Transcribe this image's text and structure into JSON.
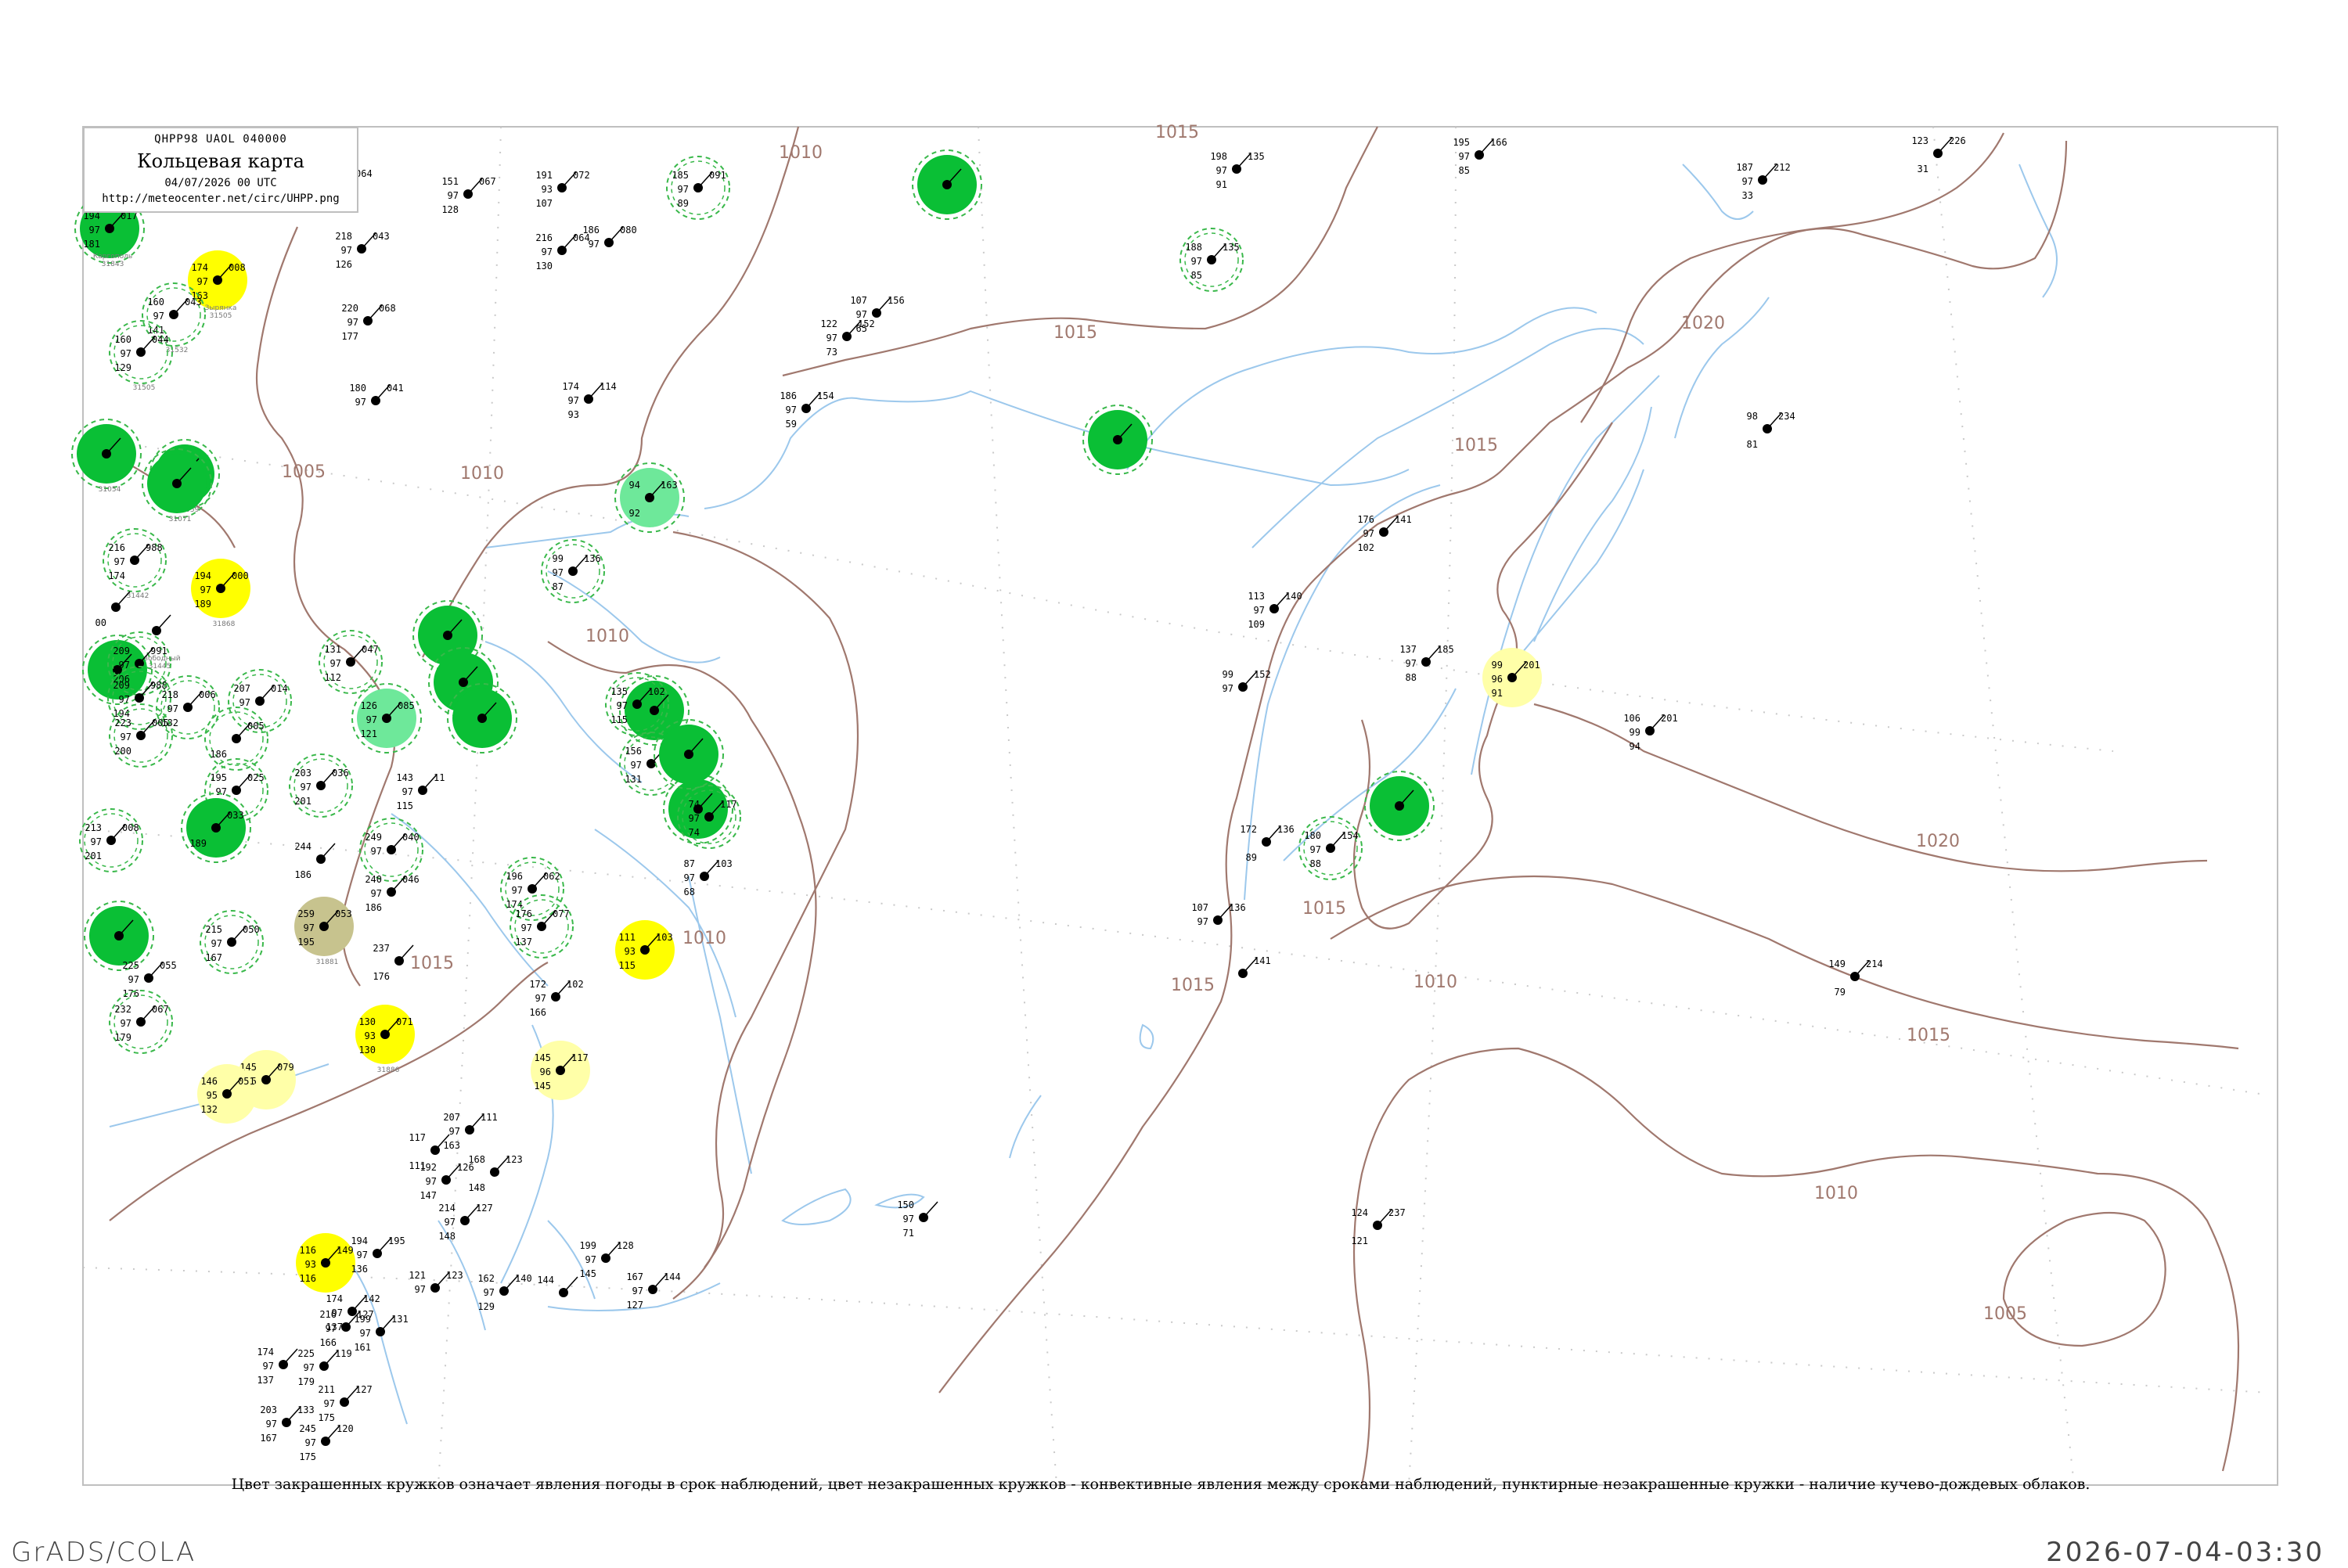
{
  "header": {
    "code": "QHPP98  UAOL  040000",
    "title": "Кольцевая карта",
    "datetime": "04/07/2026 00 UTC",
    "url": "http://meteocenter.net/circ/UHPP.png"
  },
  "footnote": "Цвет закрашенных кружков означает явления погоды в срок наблюдений, цвет незакрашенных кружков - конвективные явления между сроками наблюдений, пунктирные незакрашенные кружки - наличие кучево-дождевых облаков.",
  "footer": {
    "software": "GrADS/COLA",
    "timestamp": "2026-07-04-03:30"
  },
  "colors": {
    "isobar": "#a0786e",
    "coast": "#9cc8ec",
    "rain_green": "#0abf35",
    "light_green": "#6ee89a",
    "yellow": "#ffff00",
    "pale_yellow": "#ffffa8",
    "fog_khaki": "#c7c38e",
    "dashed_ring": "#39b84a"
  },
  "isobars": [
    {
      "label": "1005"
    },
    {
      "label": "1010"
    },
    {
      "label": "1015"
    },
    {
      "label": "1020"
    }
  ],
  "stations": [
    {
      "name": "Каргополь",
      "index": "31843",
      "marker": "rain_green",
      "v": [
        "194",
        "97",
        "181",
        "017"
      ]
    },
    {
      "name": "Зырянка",
      "index": "31505",
      "marker": "yellow",
      "v": [
        "174",
        "97",
        "163",
        "008"
      ]
    },
    {
      "name": "",
      "index": "31532",
      "marker": "ring",
      "v": [
        "160",
        "97",
        "141",
        "043"
      ]
    },
    {
      "name": "",
      "index": "31505",
      "marker": "ring",
      "v": [
        "160",
        "97",
        "129",
        "044"
      ]
    },
    {
      "name": "",
      "index": "31054",
      "marker": "rain_green",
      "v": [
        "",
        "",
        "",
        ""
      ]
    },
    {
      "name": "",
      "index": "31059",
      "marker": "rain_green",
      "v": [
        "",
        "",
        "",
        ""
      ]
    },
    {
      "name": "",
      "index": "31071",
      "marker": "rain_green",
      "v": [
        "",
        "",
        "",
        ""
      ]
    },
    {
      "name": "",
      "index": "31442",
      "marker": "ring",
      "v": [
        "216",
        "97",
        "174",
        "988"
      ]
    },
    {
      "name": "",
      "index": "31868",
      "marker": "yellow",
      "v": [
        "194",
        "97",
        "189",
        "000"
      ]
    },
    {
      "name": "",
      "index": "",
      "marker": "none",
      "v": [
        "",
        "",
        "00",
        ""
      ]
    },
    {
      "name": "Свободный",
      "index": "31445",
      "marker": "none",
      "v": [
        "",
        "",
        "",
        ""
      ]
    },
    {
      "name": "",
      "index": "",
      "marker": "rain_green",
      "v": [
        "",
        "",
        "",
        ""
      ]
    },
    {
      "name": "",
      "index": "",
      "marker": "ring",
      "v": [
        "209",
        "97",
        "206",
        "991"
      ]
    },
    {
      "name": "",
      "index": "",
      "marker": "ring",
      "v": [
        "209",
        "97",
        "194",
        "988"
      ]
    },
    {
      "name": "",
      "index": "",
      "marker": "ring",
      "v": [
        "218",
        "97",
        "182",
        "006"
      ]
    },
    {
      "name": "",
      "index": "",
      "marker": "ring",
      "v": [
        "207",
        "97",
        "",
        "014"
      ]
    },
    {
      "name": "",
      "index": "",
      "marker": "ring",
      "v": [
        "223",
        "97",
        "200",
        "005"
      ]
    },
    {
      "name": "",
      "index": "",
      "marker": "ring",
      "v": [
        "",
        "",
        "186",
        "005"
      ]
    },
    {
      "name": "",
      "index": "",
      "marker": "ring",
      "v": [
        "131",
        "97",
        "112",
        "047"
      ]
    },
    {
      "name": "",
      "index": "",
      "marker": "light_green",
      "v": [
        "126",
        "97",
        "121",
        "085"
      ]
    },
    {
      "name": "",
      "index": "",
      "marker": "ring",
      "v": [
        "203",
        "97",
        "201",
        "036"
      ]
    },
    {
      "name": "",
      "index": "",
      "marker": "ring",
      "v": [
        "195",
        "97",
        "",
        "025"
      ]
    },
    {
      "name": "",
      "index": "",
      "marker": "rain_green",
      "v": [
        "",
        "",
        "189",
        "033"
      ]
    },
    {
      "name": "",
      "index": "",
      "marker": "ring",
      "v": [
        "213",
        "97",
        "201",
        "008"
      ]
    },
    {
      "name": "",
      "index": "",
      "marker": "ring",
      "v": [
        "249",
        "97",
        "",
        "040"
      ]
    },
    {
      "name": "",
      "index": "",
      "marker": "none",
      "v": [
        "244",
        "",
        "186",
        ""
      ]
    },
    {
      "name": "",
      "index": "",
      "marker": "none",
      "v": [
        "240",
        "97",
        "186",
        "046"
      ]
    },
    {
      "name": "",
      "index": "31881",
      "marker": "fog_khaki",
      "v": [
        "259",
        "97",
        "195",
        "053"
      ]
    },
    {
      "name": "",
      "index": "",
      "marker": "rain_green",
      "v": [
        "",
        "",
        "",
        ""
      ]
    },
    {
      "name": "",
      "index": "",
      "marker": "ring",
      "v": [
        "215",
        "97",
        "167",
        "050"
      ]
    },
    {
      "name": "",
      "index": "",
      "marker": "none",
      "v": [
        "225",
        "97",
        "176",
        "055"
      ]
    },
    {
      "name": "",
      "index": "",
      "marker": "ring",
      "v": [
        "232",
        "97",
        "179",
        "067"
      ]
    },
    {
      "name": "",
      "index": "31886",
      "marker": "yellow",
      "v": [
        "130",
        "93",
        "130",
        "071"
      ]
    },
    {
      "name": "",
      "index": "",
      "marker": "pale_yellow",
      "v": [
        "145",
        "95",
        "131",
        "079"
      ]
    },
    {
      "name": "",
      "index": "",
      "marker": "pale_yellow",
      "v": [
        "146",
        "95",
        "132",
        "051"
      ]
    },
    {
      "name": "",
      "index": "",
      "marker": "none",
      "v": [
        "237",
        "",
        "176",
        ""
      ]
    },
    {
      "name": "",
      "index": "",
      "marker": "none",
      "v": [
        "209",
        "97",
        "121",
        "064"
      ]
    },
    {
      "name": "",
      "index": "",
      "marker": "none",
      "v": [
        "218",
        "97",
        "126",
        "043"
      ]
    },
    {
      "name": "",
      "index": "",
      "marker": "none",
      "v": [
        "220",
        "97",
        "177",
        "068"
      ]
    },
    {
      "name": "",
      "index": "",
      "marker": "none",
      "v": [
        "180",
        "97",
        "",
        "041"
      ]
    },
    {
      "name": "",
      "index": "",
      "marker": "none",
      "v": [
        "151",
        "97",
        "128",
        "067"
      ]
    },
    {
      "name": "",
      "index": "",
      "marker": "none",
      "v": [
        "191",
        "93",
        "107",
        "072"
      ]
    },
    {
      "name": "",
      "index": "",
      "marker": "none",
      "v": [
        "216",
        "97",
        "130",
        "064"
      ]
    },
    {
      "name": "",
      "index": "",
      "marker": "none",
      "v": [
        "186",
        "97",
        "",
        "080"
      ]
    },
    {
      "name": "",
      "index": "",
      "marker": "none",
      "v": [
        "174",
        "97",
        "93",
        "114"
      ]
    },
    {
      "name": "",
      "index": "",
      "marker": "ring",
      "v": [
        "185",
        "97",
        "89",
        "091"
      ]
    },
    {
      "name": "",
      "index": "",
      "marker": "rain_green",
      "v": [
        "",
        "",
        "",
        ""
      ]
    },
    {
      "name": "",
      "index": "",
      "marker": "ring",
      "v": [
        "99",
        "97",
        "87",
        "136"
      ]
    },
    {
      "name": "",
      "index": "",
      "marker": "light_green",
      "v": [
        "94",
        "",
        "92",
        "163"
      ]
    },
    {
      "name": "",
      "index": "",
      "marker": "none",
      "v": [
        "107",
        "97",
        "65",
        "156"
      ]
    },
    {
      "name": "",
      "index": "",
      "marker": "none",
      "v": [
        "122",
        "97",
        "73",
        "152"
      ]
    },
    {
      "name": "",
      "index": "",
      "marker": "none",
      "v": [
        "186",
        "97",
        "59",
        "154"
      ]
    },
    {
      "name": "",
      "index": "",
      "marker": "rain_green",
      "v": [
        "",
        "",
        "",
        ""
      ]
    },
    {
      "name": "",
      "index": "",
      "marker": "ring",
      "v": [
        "188",
        "97",
        "85",
        "135"
      ]
    },
    {
      "name": "",
      "index": "",
      "marker": "none",
      "v": [
        "198",
        "97",
        "91",
        "135"
      ]
    },
    {
      "name": "",
      "index": "",
      "marker": "none",
      "v": [
        "195",
        "97",
        "85",
        "166"
      ]
    },
    {
      "name": "",
      "index": "",
      "marker": "none",
      "v": [
        "187",
        "97",
        "33",
        "212"
      ]
    },
    {
      "name": "",
      "index": "",
      "marker": "none",
      "v": [
        "123",
        "",
        "31",
        "226"
      ]
    },
    {
      "name": "",
      "index": "",
      "marker": "none",
      "v": [
        "98",
        "",
        "81",
        "234"
      ]
    },
    {
      "name": "",
      "index": "",
      "marker": "none",
      "v": [
        "176",
        "97",
        "102",
        "141"
      ]
    },
    {
      "name": "",
      "index": "",
      "marker": "none",
      "v": [
        "113",
        "97",
        "109",
        "140"
      ]
    },
    {
      "name": "",
      "index": "",
      "marker": "none",
      "v": [
        "137",
        "97",
        "88",
        "185"
      ]
    },
    {
      "name": "",
      "index": "",
      "marker": "pale_yellow",
      "v": [
        "99",
        "96",
        "91",
        "201"
      ]
    },
    {
      "name": "",
      "index": "",
      "marker": "none",
      "v": [
        "106",
        "99",
        "94",
        "201"
      ]
    },
    {
      "name": "",
      "index": "",
      "marker": "none",
      "v": [
        "99",
        "97",
        "",
        "152"
      ]
    },
    {
      "name": "",
      "index": "",
      "marker": "rain_green",
      "v": [
        "",
        "",
        "",
        ""
      ]
    },
    {
      "name": "",
      "index": "",
      "marker": "ring",
      "v": [
        "180",
        "97",
        "88",
        "154"
      ]
    },
    {
      "name": "",
      "index": "",
      "marker": "none",
      "v": [
        "172",
        "",
        "89",
        "136"
      ]
    },
    {
      "name": "",
      "index": "",
      "marker": "none",
      "v": [
        "107",
        "97",
        "",
        "136"
      ]
    },
    {
      "name": "",
      "index": "",
      "marker": "none",
      "v": [
        "",
        "",
        "",
        "141"
      ]
    },
    {
      "name": "",
      "index": "",
      "marker": "none",
      "v": [
        "149",
        "",
        "79",
        "214"
      ]
    },
    {
      "name": "",
      "index": "",
      "marker": "none",
      "v": [
        "150",
        "97",
        "71",
        ""
      ]
    },
    {
      "name": "",
      "index": "",
      "marker": "none",
      "v": [
        "124",
        "",
        "121",
        "237"
      ]
    },
    {
      "name": "",
      "index": "",
      "marker": "rain_green",
      "v": [
        "",
        "",
        "",
        ""
      ]
    },
    {
      "name": "",
      "index": "",
      "marker": "ring",
      "v": [
        "135",
        "97",
        "115",
        "102"
      ]
    },
    {
      "name": "",
      "index": "",
      "marker": "ring",
      "v": [
        "156",
        "97",
        "131",
        ""
      ]
    },
    {
      "name": "",
      "index": "",
      "marker": "rain_green",
      "v": [
        "",
        "",
        "",
        ""
      ]
    },
    {
      "name": "",
      "index": "",
      "marker": "ring",
      "v": [
        "74",
        "97",
        "74",
        "117"
      ]
    },
    {
      "name": "",
      "index": "",
      "marker": "rain_green",
      "v": [
        "",
        "",
        "",
        ""
      ]
    },
    {
      "name": "",
      "index": "",
      "marker": "none",
      "v": [
        "87",
        "97",
        "68",
        "103"
      ]
    },
    {
      "name": "",
      "index": "",
      "marker": "yellow",
      "v": [
        "111",
        "93",
        "115",
        "103"
      ]
    },
    {
      "name": "",
      "index": "",
      "marker": "ring",
      "v": [
        "196",
        "97",
        "174",
        "062"
      ]
    },
    {
      "name": "",
      "index": "",
      "marker": "ring",
      "v": [
        "176",
        "97",
        "137",
        "077"
      ]
    },
    {
      "name": "",
      "index": "",
      "marker": "none",
      "v": [
        "172",
        "97",
        "166",
        "102"
      ]
    },
    {
      "name": "",
      "index": "",
      "marker": "pale_yellow",
      "v": [
        "145",
        "96",
        "145",
        "117"
      ]
    },
    {
      "name": "",
      "index": "",
      "marker": "none",
      "v": [
        "143",
        "97",
        "115",
        "11"
      ]
    },
    {
      "name": "",
      "index": "",
      "marker": "rain_green",
      "v": [
        "",
        "",
        "",
        ""
      ]
    },
    {
      "name": "",
      "index": "",
      "marker": "rain_green",
      "v": [
        "",
        "",
        "",
        ""
      ]
    },
    {
      "name": "",
      "index": "",
      "marker": "rain_green",
      "v": [
        "",
        "",
        "",
        ""
      ]
    },
    {
      "name": "",
      "index": "",
      "marker": "none",
      "v": [
        "207",
        "97",
        "163",
        "111"
      ]
    },
    {
      "name": "",
      "index": "",
      "marker": "none",
      "v": [
        "117",
        "",
        "111",
        ""
      ]
    },
    {
      "name": "",
      "index": "",
      "marker": "none",
      "v": [
        "192",
        "97",
        "147",
        "126"
      ]
    },
    {
      "name": "",
      "index": "",
      "marker": "none",
      "v": [
        "168",
        "",
        "148",
        "123"
      ]
    },
    {
      "name": "",
      "index": "",
      "marker": "none",
      "v": [
        "214",
        "97",
        "148",
        "127"
      ]
    },
    {
      "name": "",
      "index": "",
      "marker": "none",
      "v": [
        "199",
        "97",
        "145",
        "128"
      ]
    },
    {
      "name": "",
      "index": "",
      "marker": "none",
      "v": [
        "162",
        "97",
        "129",
        "140"
      ]
    },
    {
      "name": "",
      "index": "",
      "marker": "none",
      "v": [
        "144",
        "",
        "",
        ""
      ]
    },
    {
      "name": "",
      "index": "",
      "marker": "none",
      "v": [
        "167",
        "97",
        "127",
        "144"
      ]
    },
    {
      "name": "",
      "index": "",
      "marker": "yellow",
      "v": [
        "116",
        "93",
        "116",
        "149"
      ]
    },
    {
      "name": "",
      "index": "",
      "marker": "none",
      "v": [
        "194",
        "97",
        "136",
        "195"
      ]
    },
    {
      "name": "",
      "index": "",
      "marker": "none",
      "v": [
        "121",
        "97",
        "",
        "123"
      ]
    },
    {
      "name": "",
      "index": "",
      "marker": "none",
      "v": [
        "174",
        "97",
        "137",
        "142"
      ]
    },
    {
      "name": "",
      "index": "",
      "marker": "none",
      "v": [
        "216",
        "97",
        "166",
        "127"
      ]
    },
    {
      "name": "",
      "index": "",
      "marker": "none",
      "v": [
        "199",
        "97",
        "161",
        "131"
      ]
    },
    {
      "name": "",
      "index": "",
      "marker": "none",
      "v": [
        "174",
        "97",
        "137",
        ""
      ]
    },
    {
      "name": "",
      "index": "",
      "marker": "none",
      "v": [
        "225",
        "97",
        "179",
        "119"
      ]
    },
    {
      "name": "",
      "index": "",
      "marker": "none",
      "v": [
        "211",
        "97",
        "175",
        "127"
      ]
    },
    {
      "name": "",
      "index": "",
      "marker": "none",
      "v": [
        "203",
        "97",
        "167",
        "133"
      ]
    },
    {
      "name": "",
      "index": "",
      "marker": "none",
      "v": [
        "245",
        "97",
        "175",
        "120"
      ]
    },
    {
      "name": "",
      "index": "",
      "marker": "none",
      "v": [
        "206",
        "97",
        "172",
        "153"
      ]
    }
  ]
}
